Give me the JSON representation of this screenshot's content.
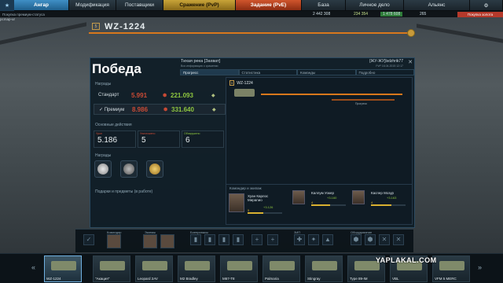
{
  "nav": {
    "items": [
      {
        "label": "Ангар",
        "state": "active"
      },
      {
        "label": "Модификация",
        "state": "normal"
      },
      {
        "label": "Поставщики",
        "state": "normal"
      },
      {
        "label": "Сражение (PvP)",
        "state": "pvp"
      },
      {
        "label": "Задание (PvE)",
        "state": "pve"
      },
      {
        "label": "База",
        "state": "normal"
      },
      {
        "label": "Личное дело",
        "state": "normal"
      },
      {
        "label": "Альянс",
        "state": "normal"
      }
    ]
  },
  "subbar": {
    "premium_link": "Покупка премиум-статуса",
    "gold_link": "Покупка золота",
    "curr1": "2 442 308",
    "curr2": "234 354",
    "curr3": "1 478 608",
    "curr4": "265",
    "corner": "pcmap-ur"
  },
  "vehicle": {
    "tier": "5",
    "name": "WZ-1224"
  },
  "result": {
    "title": "Победа",
    "map": "Тихая река [Захват]",
    "map_sub": "Вся информация о сражении",
    "player": "[ЖУ-ЖУ]lsdzhrik77",
    "player_sub": "PvP 16.04.2015 12:17",
    "tabs": [
      "Прогресс",
      "Статистика",
      "Команды",
      "Подробно"
    ],
    "rewards_label": "Награды",
    "standard_label": "Стандарт",
    "standard_silver": "5.991",
    "standard_gold": "221.093",
    "premium_label": "✓ Премиум",
    "premium_silver": "8.986",
    "premium_gold": "331.640",
    "actions_label": "Основные действия",
    "stats": [
      {
        "label": "Урон",
        "value": "5.186"
      },
      {
        "label": "Уничтожено",
        "value": "5"
      },
      {
        "label": "Обнаружено",
        "value": "6"
      }
    ],
    "medals_label": "Награды",
    "gifts_label": "Подарки и предметы (в работе)",
    "tank_label": "WZ-1224",
    "progress_label": "Прогресс",
    "crew_label": "Командир и экипаж",
    "crew": [
      {
        "name": "Хуан Карлос Мирапио",
        "xp": "+3.126",
        "level": "5",
        "progress": 0.45
      },
      {
        "name": "Каллум Уокер",
        "xp": "+3.160",
        "level": "4",
        "progress": 0.55
      },
      {
        "name": "Каспер Мозур",
        "xp": "+3.163",
        "level": "4",
        "progress": 0.6
      }
    ]
  },
  "bottom": {
    "commander": "Командир",
    "crew": "Экипаж",
    "ammo": "Боеприпасы",
    "consumables": "ЗИП",
    "equipment": "Оборудование"
  },
  "carousel": [
    {
      "name": "WZ-1224",
      "selected": true
    },
    {
      "name": "\"Акация\"",
      "selected": false
    },
    {
      "name": "Leopard 2AV",
      "selected": false
    },
    {
      "name": "M2 Bradley",
      "selected": false
    },
    {
      "name": "M67-T8",
      "selected": false
    },
    {
      "name": "Palmaria",
      "selected": false
    },
    {
      "name": "Stingray",
      "selected": false
    },
    {
      "name": "Type 89-IM",
      "selected": false
    },
    {
      "name": "VBL",
      "selected": false
    },
    {
      "name": "VFM 5 MERC",
      "selected": false
    }
  ],
  "watermark": "YAPLAKAL.COM"
}
